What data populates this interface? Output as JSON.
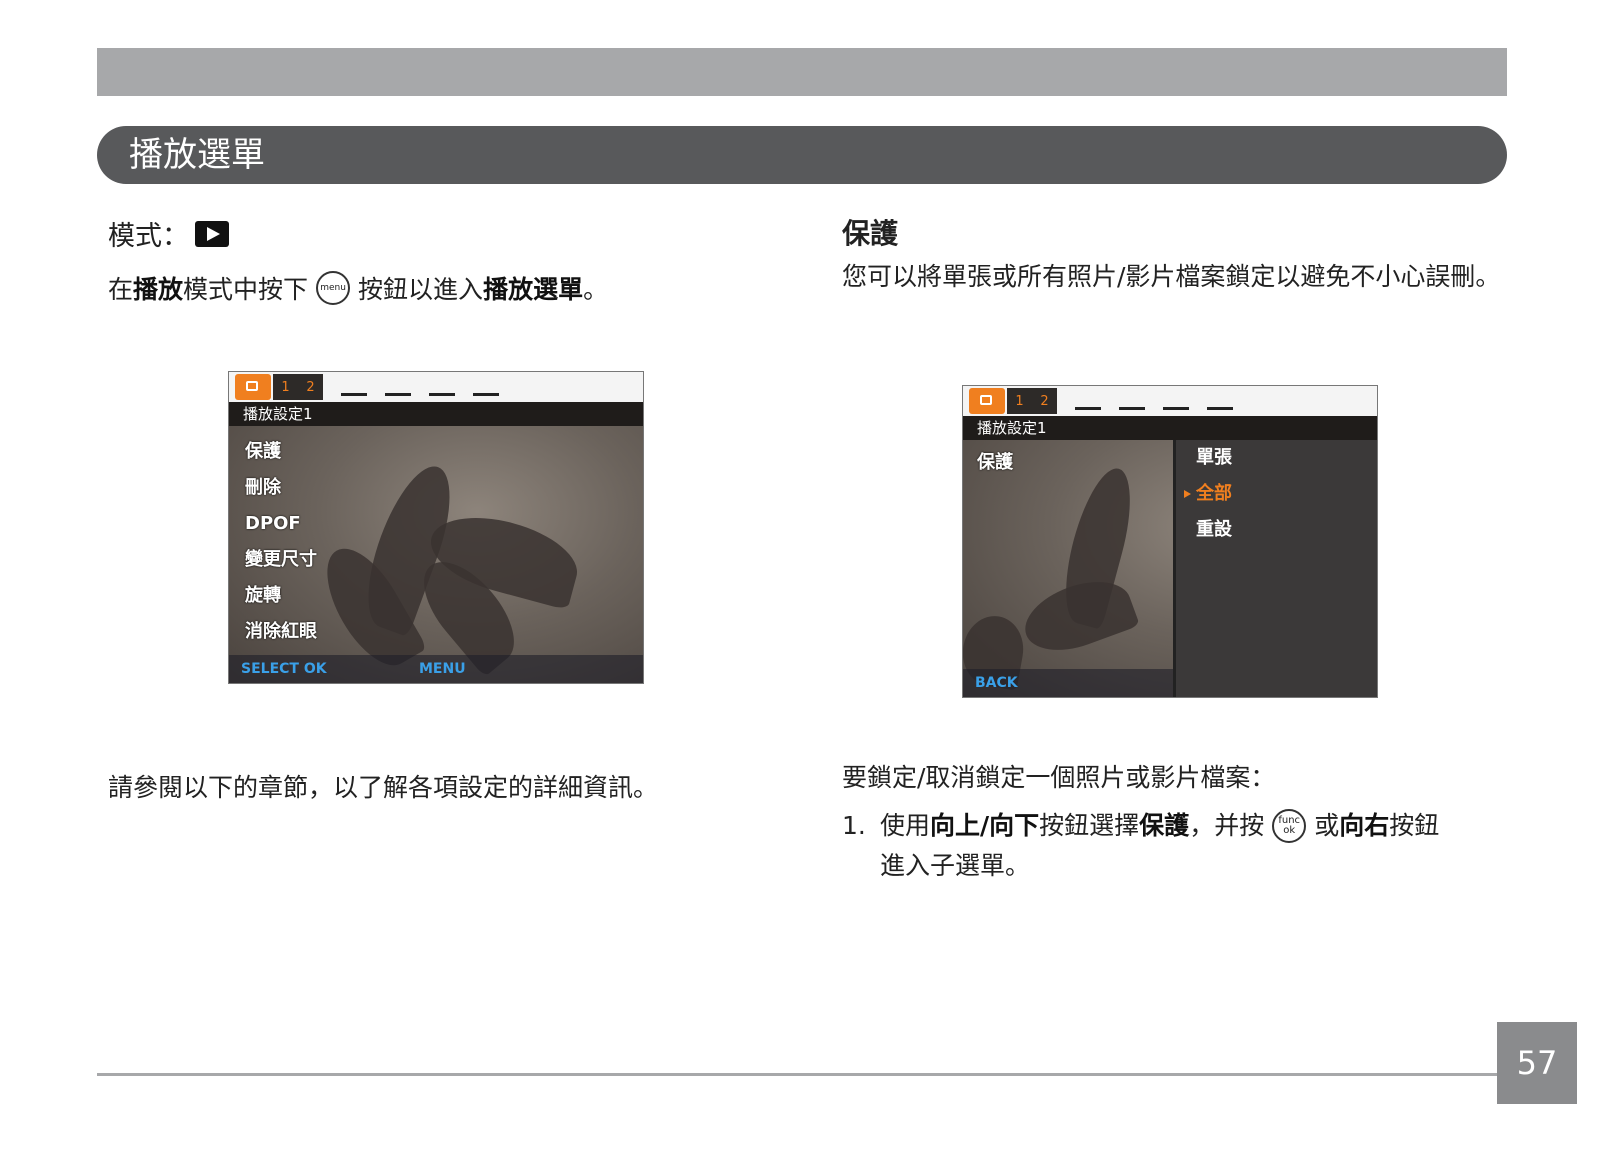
{
  "header": {
    "section_title": "播放選單"
  },
  "left": {
    "mode_label": "模式：",
    "intro": {
      "p1": "在",
      "b1": "播放",
      "p2": "模式中按下",
      "menu_btn": "menu",
      "p3": "按鈕以進入",
      "b2": "播放選單",
      "p4": "。"
    },
    "screen": {
      "title": "播放設定1",
      "tab_numbers": [
        "1",
        "2"
      ],
      "items": [
        "保護",
        "刪除",
        "DPOF",
        "變更尺寸",
        "旋轉",
        "消除紅眼"
      ],
      "footer_left": "SELECT  OK",
      "footer_right": "MENU"
    },
    "refer_text": "請參閱以下的章節，以了解各項設定的詳細資訊。"
  },
  "right": {
    "heading": "保護",
    "desc": "您可以將單張或所有照片/影片檔案鎖定以避免不小心誤刪。",
    "screen": {
      "title": "播放設定1",
      "tab_numbers": [
        "1",
        "2"
      ],
      "left_item": "保護",
      "submenu": [
        "單張",
        "全部",
        "重設"
      ],
      "selected_index": 1,
      "footer": "BACK"
    },
    "lock_text": "要鎖定/取消鎖定一個照片或影片檔案：",
    "step": {
      "num": "1.",
      "p1": "使用",
      "b1": "向上/向下",
      "p2": "按鈕選擇",
      "b2": "保護",
      "p3": "，并按",
      "btn_top": "func",
      "btn_bottom": "ok",
      "p4": "或",
      "b3": "向右",
      "p5": "按鈕",
      "cont": "進入子選單。"
    }
  },
  "footer": {
    "page_number": "57"
  },
  "colors": {
    "accent": "#f07f1f",
    "bar_gray": "#a7a8aa",
    "section_dark": "#58595b"
  }
}
